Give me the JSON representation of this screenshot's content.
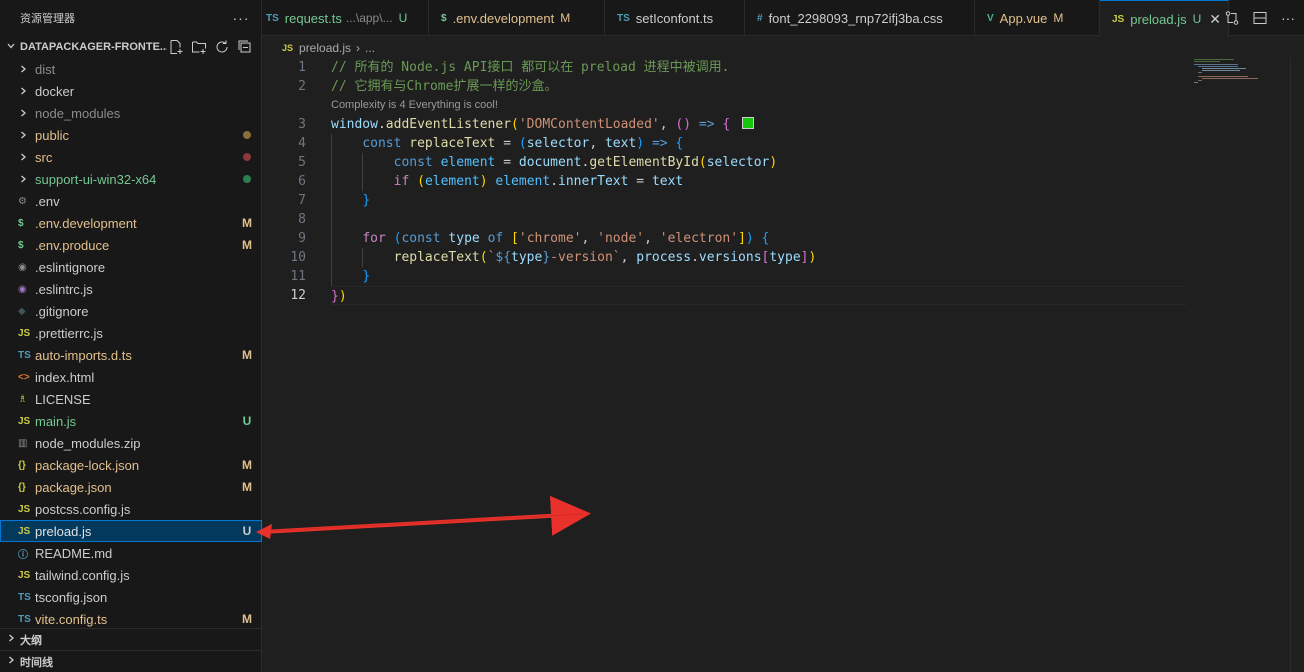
{
  "sidebar": {
    "title": "资源管理器",
    "more": "···",
    "root_label": "DATAPACKAGER-FRONTE...",
    "items": [
      {
        "label": "dist",
        "kind": "folder",
        "color": "#8c8c8c",
        "status": ""
      },
      {
        "label": "docker",
        "kind": "folder",
        "color": "#cccccc",
        "status": ""
      },
      {
        "label": "node_modules",
        "kind": "folder",
        "color": "#8c8c8c",
        "status": ""
      },
      {
        "label": "public",
        "kind": "folder",
        "color": "#e2c08d",
        "status": "dot",
        "dot_color": "#8a6d3b"
      },
      {
        "label": "src",
        "kind": "folder",
        "color": "#e2c08d",
        "status": "dot",
        "dot_color": "#8b3a3a"
      },
      {
        "label": "support-ui-win32-x64",
        "kind": "folder",
        "color": "#73c991",
        "status": "dot",
        "dot_color": "#2e7d4f"
      },
      {
        "label": ".env",
        "kind": "gear",
        "icon": "⚙",
        "icon_color": "#8c8c8c",
        "color": "#cccccc",
        "status": ""
      },
      {
        "label": ".env.development",
        "kind": "file",
        "icon": "$",
        "icon_color": "#73c991",
        "color": "#e2c08d",
        "status": "M"
      },
      {
        "label": ".env.produce",
        "kind": "file",
        "icon": "$",
        "icon_color": "#73c991",
        "color": "#e2c08d",
        "status": "M"
      },
      {
        "label": ".eslintignore",
        "kind": "file",
        "icon": "◉",
        "icon_color": "#8c8c8c",
        "color": "#cccccc",
        "status": ""
      },
      {
        "label": ".eslintrc.js",
        "kind": "file",
        "icon": "◉",
        "icon_color": "#a074c4",
        "color": "#cccccc",
        "status": ""
      },
      {
        "label": ".gitignore",
        "kind": "file",
        "icon": "◆",
        "icon_color": "#41535b",
        "color": "#cccccc",
        "status": ""
      },
      {
        "label": ".prettierrc.js",
        "kind": "file",
        "icon": "JS",
        "icon_color": "#cbcb41",
        "color": "#cccccc",
        "status": ""
      },
      {
        "label": "auto-imports.d.ts",
        "kind": "file",
        "icon": "TS",
        "icon_color": "#519aba",
        "color": "#e2c08d",
        "status": "M"
      },
      {
        "label": "index.html",
        "kind": "file",
        "icon": "<>",
        "icon_color": "#e37933",
        "color": "#cccccc",
        "status": ""
      },
      {
        "label": "LICENSE",
        "kind": "file",
        "icon": "♗",
        "icon_color": "#cbcb41",
        "color": "#cccccc",
        "status": ""
      },
      {
        "label": "main.js",
        "kind": "file",
        "icon": "JS",
        "icon_color": "#cbcb41",
        "color": "#73c991",
        "status": "U"
      },
      {
        "label": "node_modules.zip",
        "kind": "file",
        "icon": "▥",
        "icon_color": "#8c8c8c",
        "color": "#cccccc",
        "status": ""
      },
      {
        "label": "package-lock.json",
        "kind": "file",
        "icon": "{}",
        "icon_color": "#cbcb41",
        "color": "#e2c08d",
        "status": "M"
      },
      {
        "label": "package.json",
        "kind": "file",
        "icon": "{}",
        "icon_color": "#cbcb41",
        "color": "#e2c08d",
        "status": "M"
      },
      {
        "label": "postcss.config.js",
        "kind": "file",
        "icon": "JS",
        "icon_color": "#cbcb41",
        "color": "#cccccc",
        "status": ""
      },
      {
        "label": "preload.js",
        "kind": "file",
        "icon": "JS",
        "icon_color": "#cbcb41",
        "color": "#e0e0e0",
        "status": "U",
        "selected": true
      },
      {
        "label": "README.md",
        "kind": "file",
        "icon": "ⓘ",
        "icon_color": "#519aba",
        "color": "#cccccc",
        "status": ""
      },
      {
        "label": "tailwind.config.js",
        "kind": "file",
        "icon": "JS",
        "icon_color": "#cbcb41",
        "color": "#cccccc",
        "status": ""
      },
      {
        "label": "tsconfig.json",
        "kind": "file",
        "icon": "TS",
        "icon_color": "#519aba",
        "color": "#cccccc",
        "status": ""
      },
      {
        "label": "vite.config.ts",
        "kind": "file",
        "icon": "TS",
        "icon_color": "#519aba",
        "color": "#e2c08d",
        "status": "M"
      }
    ],
    "outline_label": "大纲",
    "timeline_label": "时间线"
  },
  "tabs": [
    {
      "icon": "TS",
      "icon_color": "#519aba",
      "label": "request.ts",
      "sub": "...\\app\\...",
      "status": "U",
      "label_color": "#73c991",
      "status_color": "#73c991"
    },
    {
      "icon": "$",
      "icon_color": "#73c991",
      "label": ".env.development",
      "sub": "",
      "status": "M",
      "label_color": "#e2c08d",
      "status_color": "#e2c08d"
    },
    {
      "icon": "TS",
      "icon_color": "#519aba",
      "label": "setIconfont.ts",
      "sub": "",
      "status": "",
      "label_color": "#cccccc",
      "status_color": "#cccccc"
    },
    {
      "icon": "#",
      "icon_color": "#519aba",
      "label": "font_2298093_rnp72ifj3ba.css",
      "sub": "",
      "status": "",
      "label_color": "#cccccc",
      "status_color": "#cccccc"
    },
    {
      "icon": "V",
      "icon_color": "#41b883",
      "label": "App.vue",
      "sub": "",
      "status": "M",
      "label_color": "#e2c08d",
      "status_color": "#e2c08d"
    },
    {
      "icon": "JS",
      "icon_color": "#cbcb41",
      "label": "preload.js",
      "sub": "",
      "status": "U",
      "label_color": "#73c991",
      "status_color": "#73c991",
      "active": true
    }
  ],
  "breadcrumb": {
    "file": "preload.js",
    "rest": "..."
  },
  "editor": {
    "line_numbers": [
      "1",
      "2",
      "3",
      "4",
      "5",
      "6",
      "7",
      "8",
      "9",
      "10",
      "11",
      "12"
    ],
    "current_line": "12",
    "codelens": "Complexity is 4 Everything is cool!",
    "comment1": "// 所有的 Node.js API接口 都可以在 preload 进程中被调用.",
    "comment2": "// 它拥有与Chrome扩展一样的沙盒。",
    "swatch_color": "#16c60c"
  }
}
